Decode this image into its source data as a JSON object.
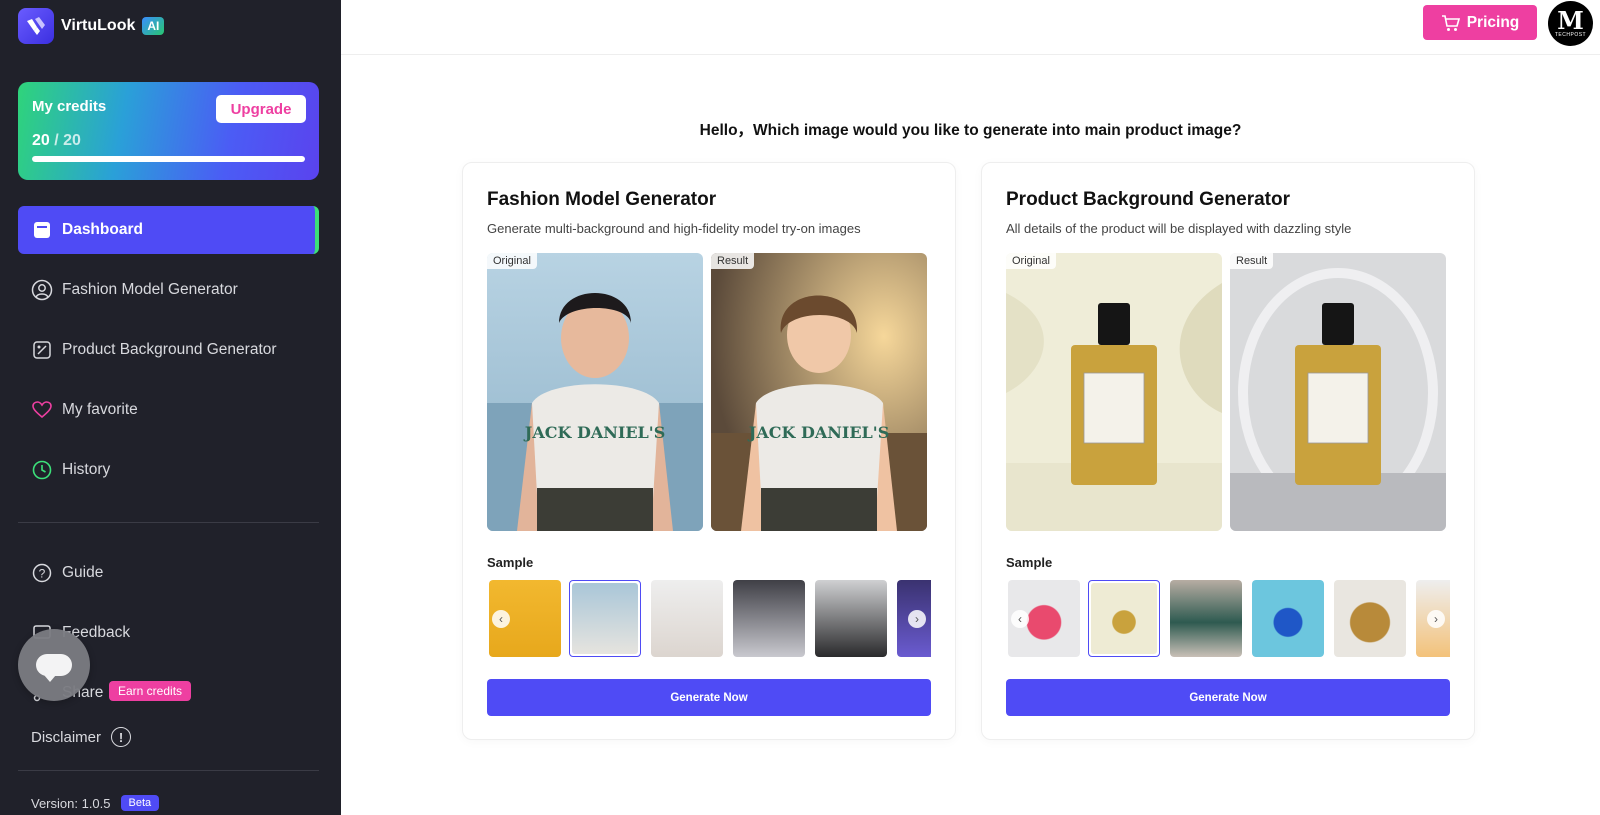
{
  "brand": {
    "name": "VirtuLook",
    "badge": "AI"
  },
  "credits": {
    "title": "My credits",
    "used": "20",
    "separator": "/",
    "total": "20",
    "fraction": 1.0,
    "upgrade_label": "Upgrade"
  },
  "sidebar": {
    "items": [
      {
        "label": "Dashboard",
        "icon": "dashboard-icon"
      },
      {
        "label": "Fashion Model Generator",
        "icon": "user-circle-icon"
      },
      {
        "label": "Product Background Generator",
        "icon": "image-edit-icon"
      },
      {
        "label": "My favorite",
        "icon": "heart-icon"
      },
      {
        "label": "History",
        "icon": "clock-icon"
      }
    ],
    "bottom_items": [
      {
        "label": "Guide",
        "icon": "question-icon"
      },
      {
        "label": "Feedback",
        "icon": "feedback-icon"
      },
      {
        "label": "Share",
        "icon": "share-icon"
      }
    ],
    "earn_badge": "Earn credits",
    "disclaimer": "Disclaimer",
    "version_label": "Version: 1.0.5",
    "beta": "Beta"
  },
  "topbar": {
    "pricing_label": "Pricing",
    "avatar_letter": "M",
    "avatar_text": "TECHPOST"
  },
  "greeting": "Hello，Which image would you like to generate into main product image?",
  "cards": [
    {
      "title": "Fashion Model Generator",
      "subtitle": "Generate multi-background and high-fidelity model try-on images",
      "original_tag": "Original",
      "result_tag": "Result",
      "sample_label": "Sample",
      "button": "Generate Now"
    },
    {
      "title": "Product Background Generator",
      "subtitle": "All details of the product will be displayed with dazzling style",
      "original_tag": "Original",
      "result_tag": "Result",
      "sample_label": "Sample",
      "button": "Generate Now"
    }
  ],
  "colors": {
    "accent": "#4f4bf5",
    "pink": "#ee3fa1",
    "sidebar": "#20212a"
  }
}
